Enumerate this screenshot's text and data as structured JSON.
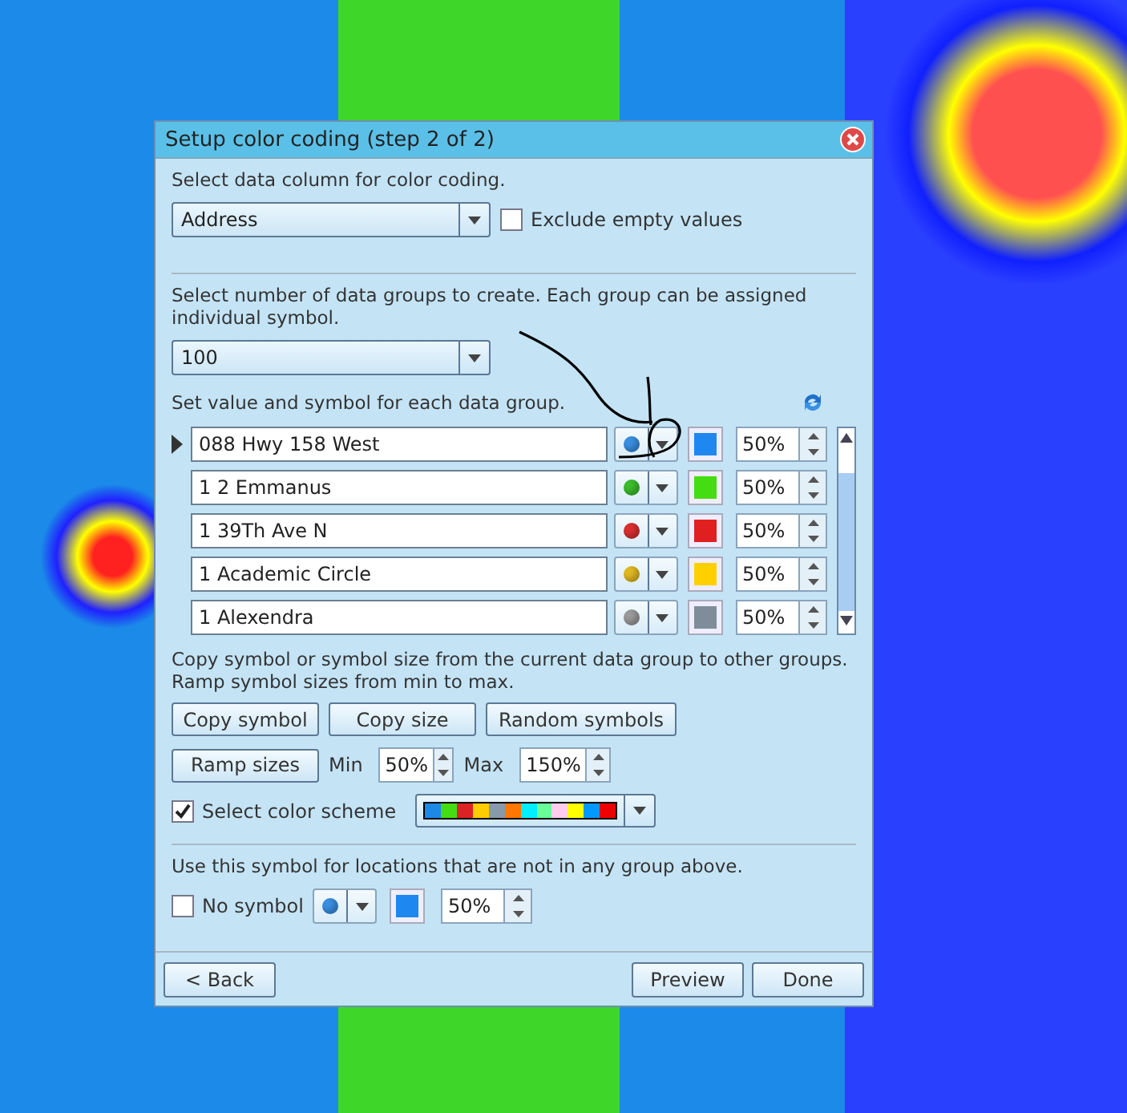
{
  "dialog": {
    "title": "Setup color coding (step 2 of 2)"
  },
  "column_section": {
    "label": "Select data column for color coding.",
    "column": "Address",
    "exclude_empty": {
      "label": "Exclude empty values",
      "checked": false
    }
  },
  "groups_section": {
    "label": "Select number of data groups to create. Each group can be assigned individual symbol.",
    "count": "100"
  },
  "values_section": {
    "label": "Set value and symbol for each data group.",
    "rows": [
      {
        "value": "088 Hwy 158 West",
        "selected": true,
        "symbol": {
          "color": "#3a8ee0"
        },
        "swatch": {
          "color": "#1e88f0"
        },
        "size": "50%"
      },
      {
        "value": "1 2 Emmanus",
        "selected": false,
        "symbol": {
          "color": "#3cbc2c"
        },
        "swatch": {
          "color": "#44dd11"
        },
        "size": "50%"
      },
      {
        "value": "1 39Th Ave N",
        "selected": false,
        "symbol": {
          "color": "#d83030"
        },
        "swatch": {
          "color": "#e02020"
        },
        "size": "50%"
      },
      {
        "value": "1 Academic Circle",
        "selected": false,
        "symbol": {
          "color": "#e0b820"
        },
        "swatch": {
          "color": "#ffd000"
        },
        "size": "50%"
      },
      {
        "value": "1 Alexendra",
        "selected": false,
        "symbol": {
          "color": "#9a9a9a"
        },
        "swatch": {
          "color": "#7f8c99"
        },
        "size": "50%"
      }
    ]
  },
  "copy_section": {
    "label": "Copy symbol or symbol size from the current data group to other groups. Ramp symbol sizes from min to max.",
    "buttons": [
      "Copy symbol",
      "Copy size",
      "Random symbols"
    ],
    "ramp_button": "Ramp sizes",
    "min_label": "Min",
    "min": "50%",
    "max_label": "Max",
    "max": "150%"
  },
  "color_scheme": {
    "label": "Select color scheme",
    "checked": true,
    "colors": [
      {
        "color": "#1e88e5"
      },
      {
        "color": "#44dd11"
      },
      {
        "color": "#dd2222"
      },
      {
        "color": "#ffcc00"
      },
      {
        "color": "#8899aa"
      },
      {
        "color": "#ff7700"
      },
      {
        "color": "#00eeff"
      },
      {
        "color": "#66ff99"
      },
      {
        "color": "#ffccee"
      },
      {
        "color": "#ffff00"
      },
      {
        "color": "#0099ff"
      },
      {
        "color": "#ee0000"
      }
    ]
  },
  "other_section": {
    "label": "Use this symbol for locations that are not in any group above.",
    "no_symbol": {
      "label": "No symbol",
      "checked": false
    },
    "symbol": {
      "color": "#3a8ee0"
    },
    "swatch": {
      "color": "#1e88f0"
    },
    "size": "50%"
  },
  "footer": {
    "back": "< Back",
    "preview": "Preview",
    "done": "Done"
  }
}
